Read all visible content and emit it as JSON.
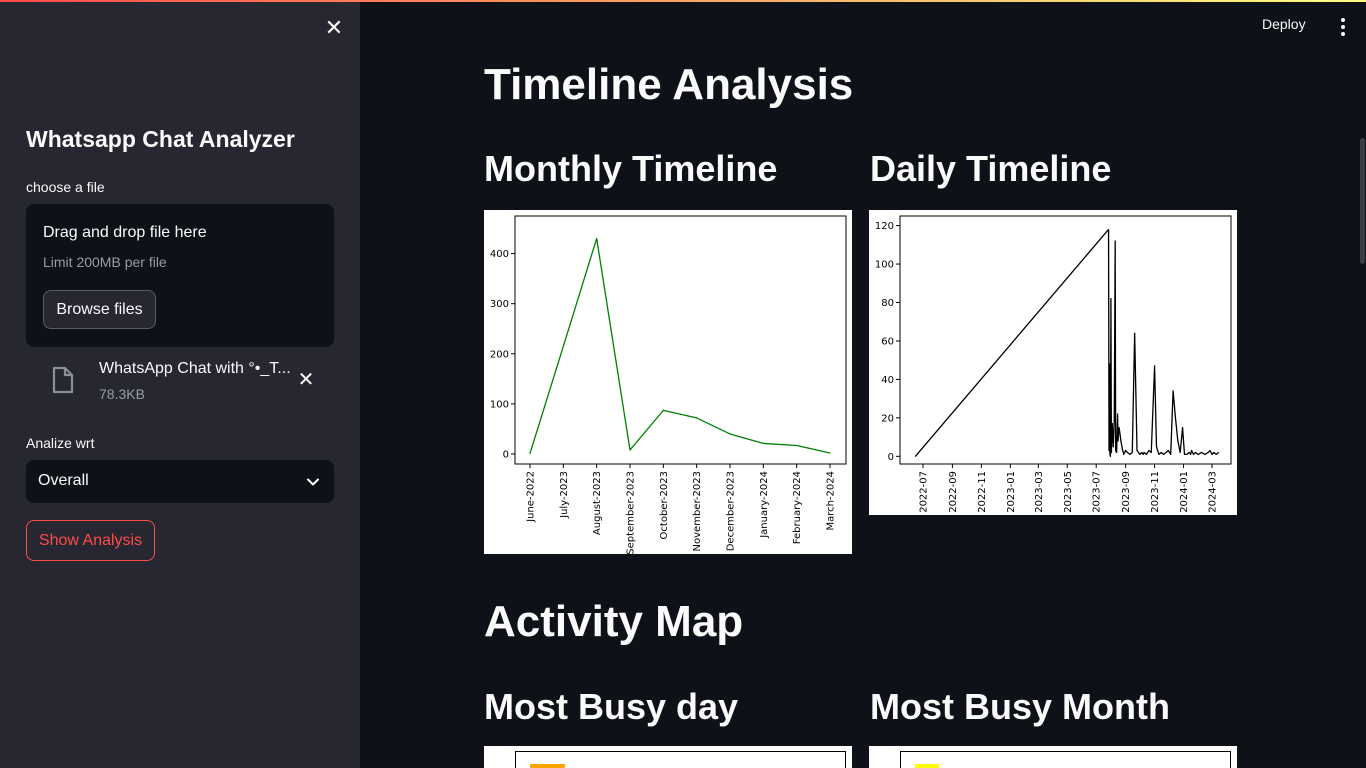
{
  "colors": {
    "accent": "#ff4b4b",
    "sidebar_bg": "#262730",
    "main_bg": "#0e1117",
    "monthly_line": "#008000",
    "daily_line": "#000000"
  },
  "header": {
    "deploy_label": "Deploy",
    "menu_icon": "vertical-dots-icon"
  },
  "sidebar": {
    "close_icon": "close-icon",
    "title": "Whatsapp Chat Analyzer",
    "file_label": "choose a file",
    "uploader": {
      "main_text": "Drag and drop file here",
      "limit_text": "Limit 200MB per file",
      "browse_label": "Browse files"
    },
    "uploaded_file": {
      "name": "WhatsApp Chat with °•_T...",
      "size": "78.3KB",
      "icon": "file-icon"
    },
    "analyze_label": "Analize wrt",
    "analyze_value": "Overall",
    "show_button": "Show Analysis"
  },
  "main": {
    "timeline_title": "Timeline Analysis",
    "monthly_title": "Monthly Timeline",
    "daily_title": "Daily Timeline",
    "activity_title": "Activity Map",
    "busy_day_title": "Most Busy day",
    "busy_month_title": "Most Busy Month"
  },
  "chart_data": [
    {
      "type": "line",
      "title": "",
      "categories": [
        "June-2022",
        "July-2023",
        "August-2023",
        "September-2023",
        "October-2023",
        "November-2023",
        "December-2023",
        "January-2024",
        "February-2024",
        "March-2024"
      ],
      "values": [
        1,
        215,
        430,
        8,
        87,
        72,
        40,
        21,
        17,
        2
      ],
      "ylim": [
        -20,
        475
      ],
      "yticks": [
        "0",
        "100",
        "200",
        "300",
        "400"
      ],
      "color": "#008000",
      "grid": false
    },
    {
      "type": "line",
      "title": "",
      "x_ticks": [
        "2022-07",
        "2022-09",
        "2022-11",
        "2023-01",
        "2023-03",
        "2023-05",
        "2023-07",
        "2023-09",
        "2023-11",
        "2024-01",
        "2024-03"
      ],
      "yticks": [
        "0",
        "20",
        "40",
        "60",
        "80",
        "100",
        "120"
      ],
      "ylim": [
        -4,
        125
      ],
      "color": "#000000",
      "grid": false,
      "x": [
        "2022-06-15",
        "2023-07-27",
        "2023-07-28",
        "2023-07-29",
        "2023-07-30",
        "2023-07-31",
        "2023-08-01",
        "2023-08-02",
        "2023-08-04",
        "2023-08-06",
        "2023-08-08",
        "2023-08-10",
        "2023-08-11",
        "2023-08-13",
        "2023-08-15",
        "2023-08-16",
        "2023-08-18",
        "2023-08-20",
        "2023-08-22",
        "2023-08-25",
        "2023-08-28",
        "2023-09-01",
        "2023-09-05",
        "2023-09-10",
        "2023-09-15",
        "2023-09-20",
        "2023-09-25",
        "2023-10-01",
        "2023-10-05",
        "2023-10-08",
        "2023-10-10",
        "2023-10-15",
        "2023-10-20",
        "2023-10-25",
        "2023-11-01",
        "2023-11-05",
        "2023-11-10",
        "2023-11-15",
        "2023-11-20",
        "2023-11-25",
        "2023-11-30",
        "2023-12-05",
        "2023-12-10",
        "2023-12-15",
        "2023-12-20",
        "2023-12-25",
        "2023-12-30",
        "2024-01-03",
        "2024-01-08",
        "2024-01-13",
        "2024-01-16",
        "2024-01-18",
        "2024-01-22",
        "2024-01-26",
        "2024-02-01",
        "2024-02-08",
        "2024-02-15",
        "2024-02-22",
        "2024-02-26",
        "2024-03-01",
        "2024-03-05",
        "2024-03-10",
        "2024-03-15"
      ],
      "y": [
        0,
        118,
        3,
        48,
        1,
        0,
        82,
        2,
        17,
        5,
        18,
        112,
        3,
        2,
        22,
        8,
        15,
        12,
        8,
        4,
        1,
        3,
        2,
        1,
        2,
        64,
        3,
        1,
        2,
        1,
        2,
        1,
        3,
        2,
        47,
        5,
        1,
        2,
        1,
        2,
        3,
        1,
        34,
        20,
        8,
        2,
        15,
        1,
        1,
        2,
        1,
        3,
        1,
        2,
        1,
        2,
        1,
        2,
        3,
        1,
        2,
        1,
        2
      ]
    }
  ]
}
